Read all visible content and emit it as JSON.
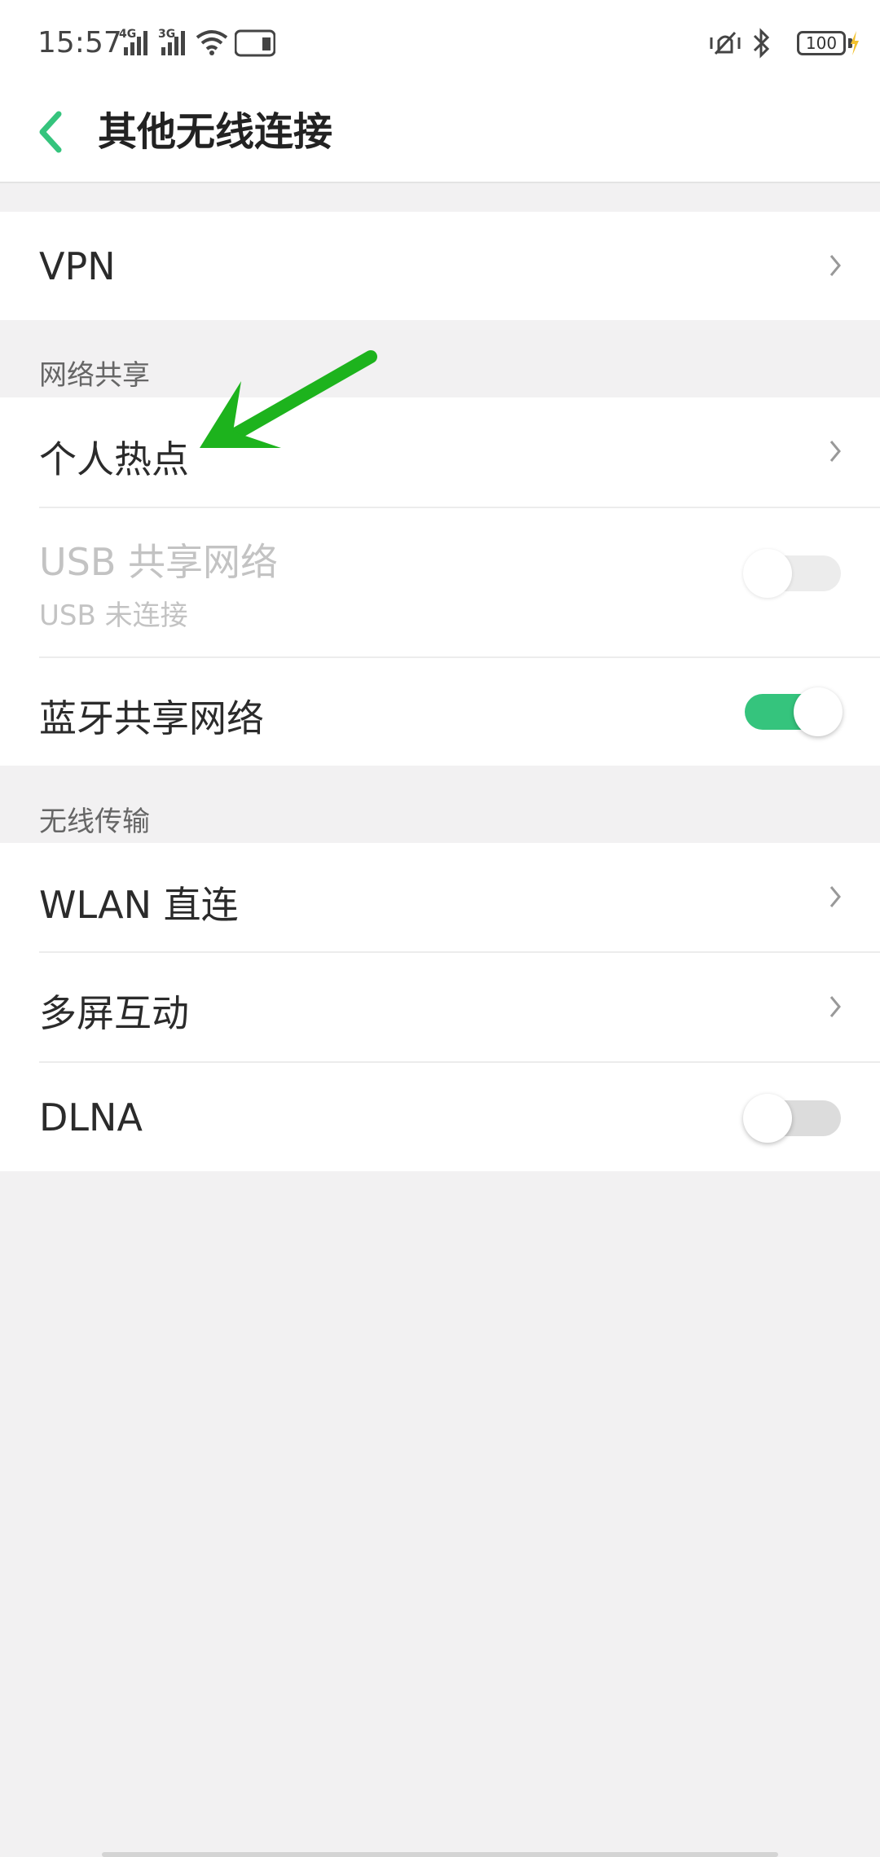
{
  "status_bar": {
    "time": "15:57",
    "network1": "4G",
    "network2": "3G",
    "battery": "100"
  },
  "header": {
    "title": "其他无线连接"
  },
  "vpn": {
    "label": "VPN"
  },
  "sharing": {
    "section_title": "网络共享",
    "hotspot_label": "个人热点",
    "usb_label": "USB 共享网络",
    "usb_sub": "USB 未连接",
    "bt_label": "蓝牙共享网络",
    "bt_state": "on"
  },
  "wireless": {
    "section_title": "无线传输",
    "wlan_direct_label": "WLAN 直连",
    "multiscreen_label": "多屏互动",
    "dlna_label": "DLNA",
    "dlna_state": "off"
  },
  "colors": {
    "accent": "#35c47d",
    "arrow": "#1db31d"
  }
}
